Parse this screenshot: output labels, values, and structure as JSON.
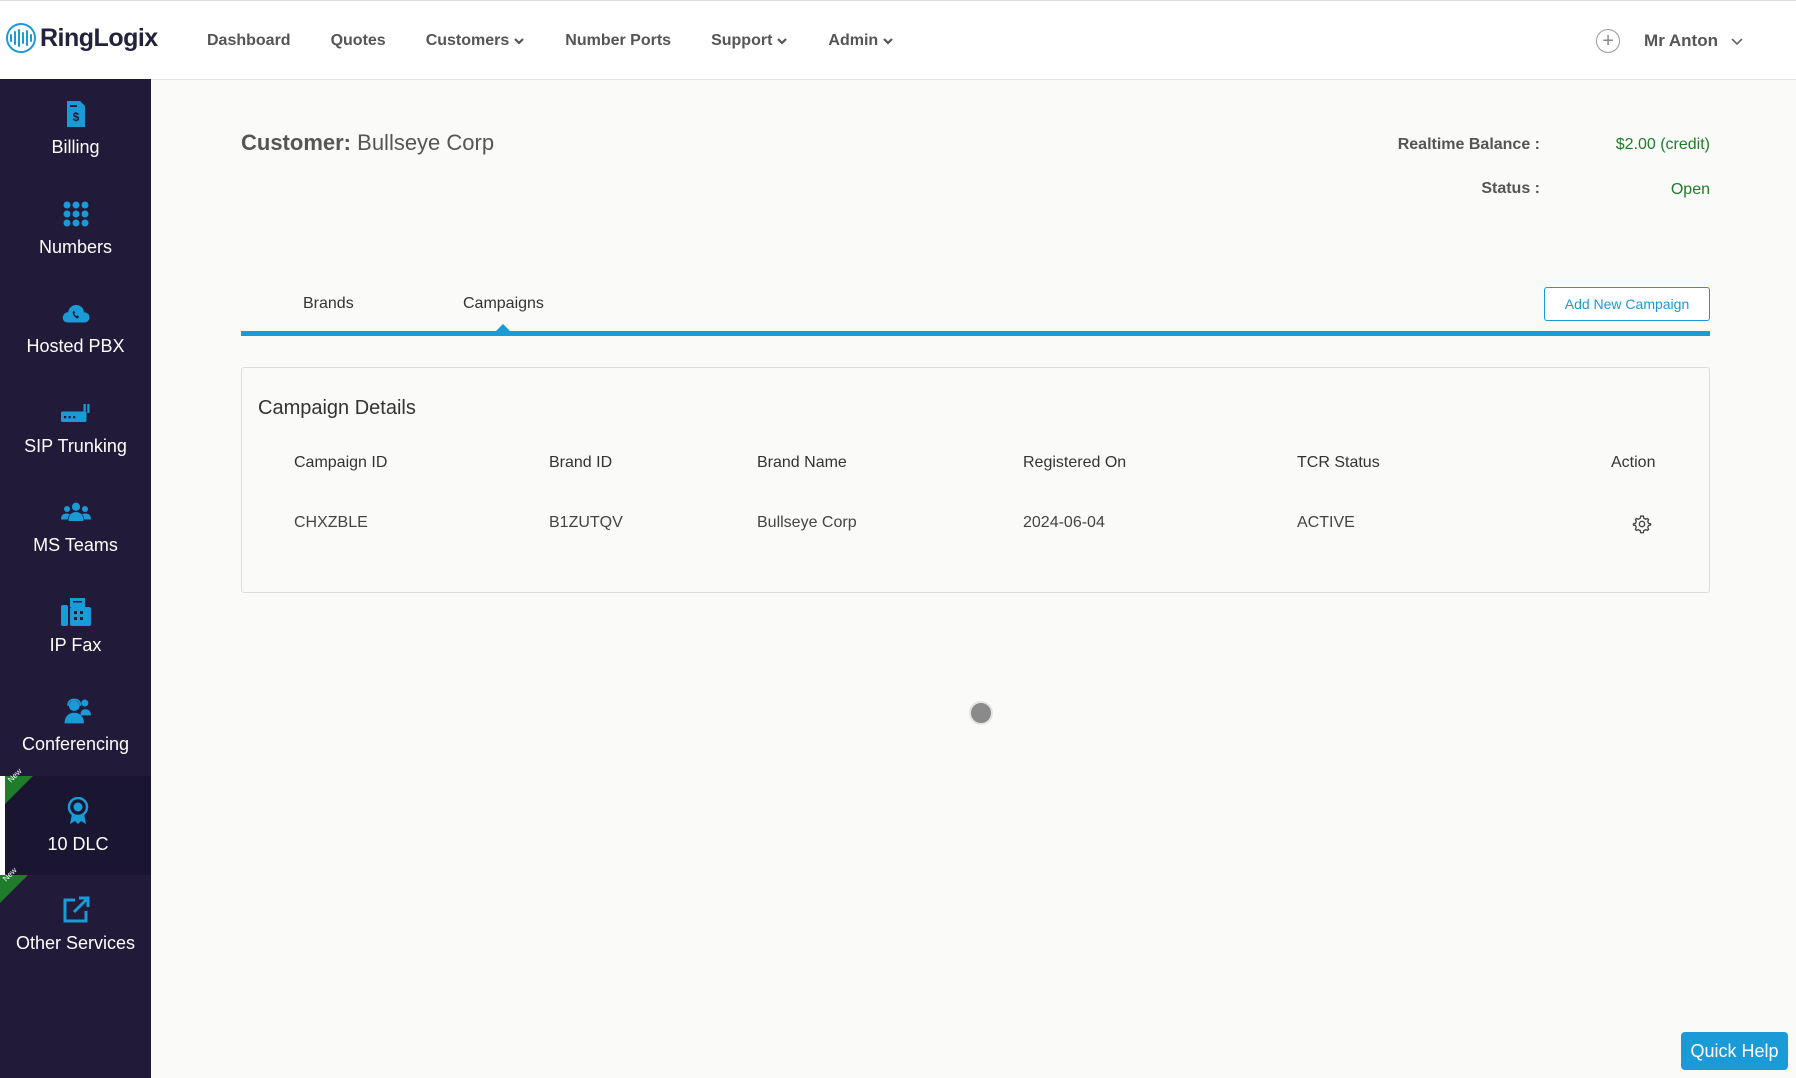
{
  "app": {
    "logo_text": "RingLogix"
  },
  "nav": {
    "items": [
      {
        "label": "Dashboard"
      },
      {
        "label": "Quotes"
      },
      {
        "label": "Customers"
      },
      {
        "label": "Number Ports"
      },
      {
        "label": "Support"
      },
      {
        "label": "Admin"
      }
    ],
    "user": "Mr Anton"
  },
  "sidebar": {
    "items": [
      {
        "label": "Billing",
        "icon": "billing-icon"
      },
      {
        "label": "Numbers",
        "icon": "dialpad-icon"
      },
      {
        "label": "Hosted PBX",
        "icon": "cloud-phone-icon"
      },
      {
        "label": "SIP Trunking",
        "icon": "router-icon"
      },
      {
        "label": "MS Teams",
        "icon": "team-icon"
      },
      {
        "label": "IP Fax",
        "icon": "fax-icon"
      },
      {
        "label": "Conferencing",
        "icon": "headset-user-icon"
      },
      {
        "label": "10 DLC",
        "icon": "award-icon",
        "badge": "New",
        "active": true
      },
      {
        "label": "Other Services",
        "icon": "external-link-icon",
        "badge": "New"
      }
    ],
    "new_badge": "New"
  },
  "customer": {
    "label": "Customer:",
    "name": "Bullseye Corp",
    "balance_label": "Realtime Balance :",
    "balance_value": "$2.00 (credit)",
    "status_label": "Status :",
    "status_value": "Open"
  },
  "tabs": [
    {
      "label": "Brands"
    },
    {
      "label": "Campaigns",
      "active": true
    }
  ],
  "add_campaign_label": "Add New Campaign",
  "campaign_details": {
    "title": "Campaign Details",
    "headers": [
      "Campaign ID",
      "Brand ID",
      "Brand Name",
      "Registered On",
      "TCR Status",
      "Action"
    ],
    "rows": [
      {
        "campaign_id": "CHXZBLE",
        "brand_id": "B1ZUTQV",
        "brand_name": "Bullseye Corp",
        "registered_on": "2024-06-04",
        "tcr_status": "ACTIVE",
        "action_icon": "gear-icon"
      }
    ]
  },
  "quick_help_label": "Quick Help",
  "colors": {
    "accent": "#1a9ad6",
    "sidebar_bg": "#211a39",
    "success": "#1e7d2a"
  }
}
